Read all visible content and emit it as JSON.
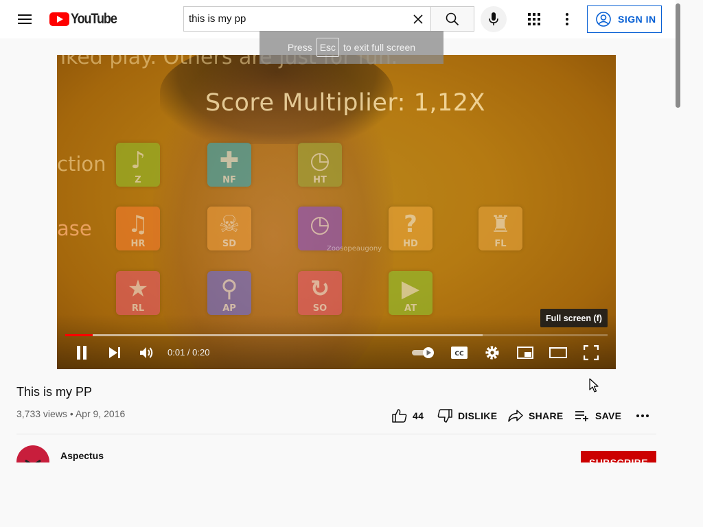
{
  "header": {
    "logo_text": "YouTube",
    "search": {
      "value": "this is my pp",
      "placeholder": "Search"
    },
    "signin_label": "SIGN IN"
  },
  "player": {
    "esc_hint": {
      "prefix": "Press",
      "key": "Esc",
      "suffix": "to exit full screen"
    },
    "video_text": {
      "top": "nked play. Others are just for fun.",
      "score": "Score Multiplier: 1,12X",
      "action": "ction",
      "ease": "ase"
    },
    "mods": [
      {
        "label": "Z",
        "glyph": "♪",
        "color": "#8fb829"
      },
      {
        "label": "NF",
        "glyph": "✚",
        "color": "#36a8b8"
      },
      {
        "label": "HT",
        "glyph": "◷",
        "color": "#9aa43a"
      },
      {
        "label": "HR",
        "glyph": "♫",
        "color": "#f27a2c"
      },
      {
        "label": "SD",
        "glyph": "☠",
        "color": "#e99a3a"
      },
      {
        "label": "",
        "glyph": "◷",
        "color": "#8a4fc8"
      },
      {
        "label": "HD",
        "glyph": "?",
        "color": "#e9a43a"
      },
      {
        "label": "FL",
        "glyph": "♜",
        "color": "#e3a13c"
      },
      {
        "label": "RL",
        "glyph": "★",
        "color": "#e5576a"
      },
      {
        "label": "AP",
        "glyph": "⚲",
        "color": "#6a6ad8"
      },
      {
        "label": "SO",
        "glyph": "↻",
        "color": "#e5576a"
      },
      {
        "label": "AT",
        "glyph": "▶",
        "color": "#8ec030"
      }
    ],
    "watermark": "Zoosopeaugony",
    "tooltip": "Full screen (f)",
    "time_current": "0:01",
    "time_total": "0:20",
    "time_display": "0:01 / 0:20",
    "progress_fraction": 0.05,
    "buffer_fraction": 0.77
  },
  "video": {
    "title": "This is my PP",
    "views": "3,733 views",
    "date": "Apr 9, 2016",
    "info": "3,733 views • Apr 9, 2016",
    "actions": {
      "like_count": "44",
      "dislike_label": "DISLIKE",
      "share_label": "SHARE",
      "save_label": "SAVE"
    }
  },
  "channel": {
    "name": "Aspectus",
    "subscribe_label": "SUBSCRIBE"
  },
  "colors": {
    "brand_red": "#ff0000",
    "link_blue": "#065fd4",
    "subscribe_red": "#cc0000",
    "avatar": "#c81e3c"
  }
}
